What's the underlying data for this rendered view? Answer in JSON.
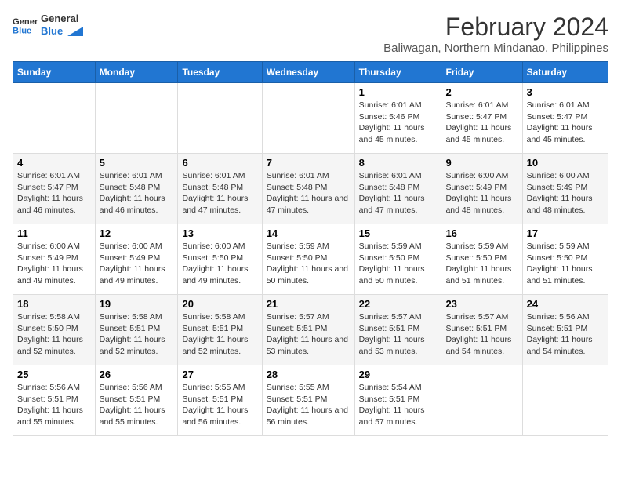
{
  "app": {
    "name": "GeneralBlue",
    "title": "February 2024",
    "subtitle": "Baliwagan, Northern Mindanao, Philippines"
  },
  "calendar": {
    "headers": [
      "Sunday",
      "Monday",
      "Tuesday",
      "Wednesday",
      "Thursday",
      "Friday",
      "Saturday"
    ],
    "weeks": [
      [
        {
          "day": "",
          "info": ""
        },
        {
          "day": "",
          "info": ""
        },
        {
          "day": "",
          "info": ""
        },
        {
          "day": "",
          "info": ""
        },
        {
          "day": "1",
          "sunrise": "6:01 AM",
          "sunset": "5:46 PM",
          "daylight": "11 hours and 45 minutes."
        },
        {
          "day": "2",
          "sunrise": "6:01 AM",
          "sunset": "5:47 PM",
          "daylight": "11 hours and 45 minutes."
        },
        {
          "day": "3",
          "sunrise": "6:01 AM",
          "sunset": "5:47 PM",
          "daylight": "11 hours and 45 minutes."
        }
      ],
      [
        {
          "day": "4",
          "sunrise": "6:01 AM",
          "sunset": "5:47 PM",
          "daylight": "11 hours and 46 minutes."
        },
        {
          "day": "5",
          "sunrise": "6:01 AM",
          "sunset": "5:48 PM",
          "daylight": "11 hours and 46 minutes."
        },
        {
          "day": "6",
          "sunrise": "6:01 AM",
          "sunset": "5:48 PM",
          "daylight": "11 hours and 47 minutes."
        },
        {
          "day": "7",
          "sunrise": "6:01 AM",
          "sunset": "5:48 PM",
          "daylight": "11 hours and 47 minutes."
        },
        {
          "day": "8",
          "sunrise": "6:01 AM",
          "sunset": "5:48 PM",
          "daylight": "11 hours and 47 minutes."
        },
        {
          "day": "9",
          "sunrise": "6:00 AM",
          "sunset": "5:49 PM",
          "daylight": "11 hours and 48 minutes."
        },
        {
          "day": "10",
          "sunrise": "6:00 AM",
          "sunset": "5:49 PM",
          "daylight": "11 hours and 48 minutes."
        }
      ],
      [
        {
          "day": "11",
          "sunrise": "6:00 AM",
          "sunset": "5:49 PM",
          "daylight": "11 hours and 49 minutes."
        },
        {
          "day": "12",
          "sunrise": "6:00 AM",
          "sunset": "5:49 PM",
          "daylight": "11 hours and 49 minutes."
        },
        {
          "day": "13",
          "sunrise": "6:00 AM",
          "sunset": "5:50 PM",
          "daylight": "11 hours and 49 minutes."
        },
        {
          "day": "14",
          "sunrise": "5:59 AM",
          "sunset": "5:50 PM",
          "daylight": "11 hours and 50 minutes."
        },
        {
          "day": "15",
          "sunrise": "5:59 AM",
          "sunset": "5:50 PM",
          "daylight": "11 hours and 50 minutes."
        },
        {
          "day": "16",
          "sunrise": "5:59 AM",
          "sunset": "5:50 PM",
          "daylight": "11 hours and 51 minutes."
        },
        {
          "day": "17",
          "sunrise": "5:59 AM",
          "sunset": "5:50 PM",
          "daylight": "11 hours and 51 minutes."
        }
      ],
      [
        {
          "day": "18",
          "sunrise": "5:58 AM",
          "sunset": "5:50 PM",
          "daylight": "11 hours and 52 minutes."
        },
        {
          "day": "19",
          "sunrise": "5:58 AM",
          "sunset": "5:51 PM",
          "daylight": "11 hours and 52 minutes."
        },
        {
          "day": "20",
          "sunrise": "5:58 AM",
          "sunset": "5:51 PM",
          "daylight": "11 hours and 52 minutes."
        },
        {
          "day": "21",
          "sunrise": "5:57 AM",
          "sunset": "5:51 PM",
          "daylight": "11 hours and 53 minutes."
        },
        {
          "day": "22",
          "sunrise": "5:57 AM",
          "sunset": "5:51 PM",
          "daylight": "11 hours and 53 minutes."
        },
        {
          "day": "23",
          "sunrise": "5:57 AM",
          "sunset": "5:51 PM",
          "daylight": "11 hours and 54 minutes."
        },
        {
          "day": "24",
          "sunrise": "5:56 AM",
          "sunset": "5:51 PM",
          "daylight": "11 hours and 54 minutes."
        }
      ],
      [
        {
          "day": "25",
          "sunrise": "5:56 AM",
          "sunset": "5:51 PM",
          "daylight": "11 hours and 55 minutes."
        },
        {
          "day": "26",
          "sunrise": "5:56 AM",
          "sunset": "5:51 PM",
          "daylight": "11 hours and 55 minutes."
        },
        {
          "day": "27",
          "sunrise": "5:55 AM",
          "sunset": "5:51 PM",
          "daylight": "11 hours and 56 minutes."
        },
        {
          "day": "28",
          "sunrise": "5:55 AM",
          "sunset": "5:51 PM",
          "daylight": "11 hours and 56 minutes."
        },
        {
          "day": "29",
          "sunrise": "5:54 AM",
          "sunset": "5:51 PM",
          "daylight": "11 hours and 57 minutes."
        },
        {
          "day": "",
          "info": ""
        },
        {
          "day": "",
          "info": ""
        }
      ]
    ]
  },
  "labels": {
    "sunrise_prefix": "Sunrise: ",
    "sunset_prefix": "Sunset: ",
    "daylight_prefix": "Daylight: "
  }
}
